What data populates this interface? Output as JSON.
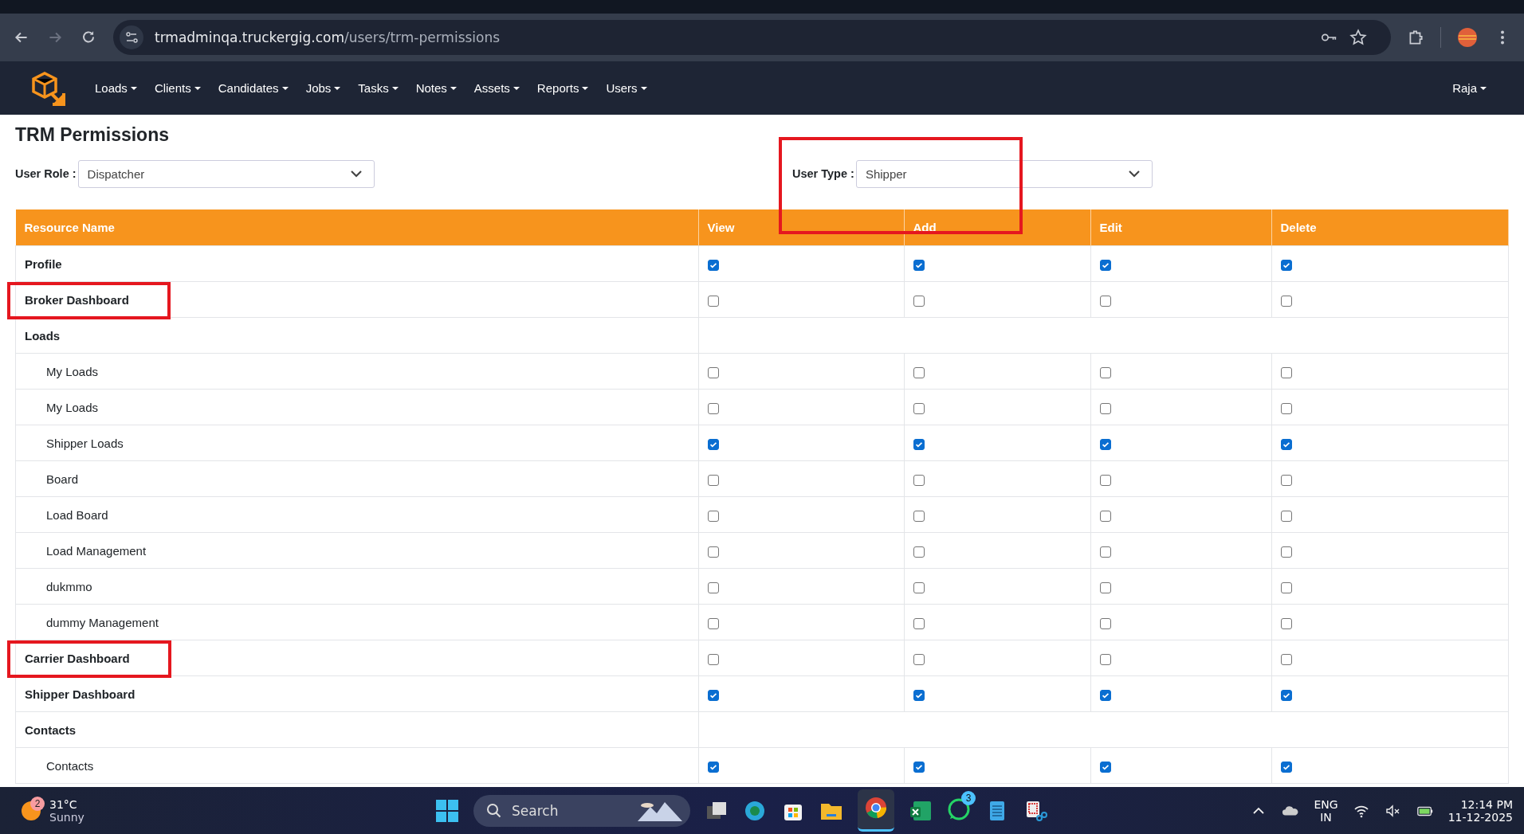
{
  "browser": {
    "url_host": "trmadminqa.truckergig.com",
    "url_path": "/users/trm-permissions"
  },
  "nav": {
    "items": [
      {
        "label": "Loads"
      },
      {
        "label": "Clients"
      },
      {
        "label": "Candidates"
      },
      {
        "label": "Jobs"
      },
      {
        "label": "Tasks"
      },
      {
        "label": "Notes"
      },
      {
        "label": "Assets"
      },
      {
        "label": "Reports"
      },
      {
        "label": "Users"
      }
    ],
    "user": "Raja"
  },
  "page": {
    "title": "TRM Permissions"
  },
  "filters": [
    {
      "label": "User Role :",
      "value": "Dispatcher",
      "highlighted": false
    },
    {
      "label": "User Type :",
      "value": "Shipper",
      "highlighted": true
    }
  ],
  "table": {
    "columns": [
      "Resource Name",
      "View",
      "Add",
      "Edit",
      "Delete"
    ],
    "rows": [
      {
        "name": "Profile",
        "kind": "top",
        "highlighted": false,
        "perms": [
          true,
          true,
          true,
          true
        ]
      },
      {
        "name": "Broker Dashboard",
        "kind": "top",
        "highlighted": true,
        "perms": [
          false,
          false,
          false,
          false
        ]
      },
      {
        "name": "Loads",
        "kind": "group",
        "highlighted": false
      },
      {
        "name": "My Loads",
        "kind": "sub",
        "highlighted": false,
        "perms": [
          false,
          false,
          false,
          false
        ]
      },
      {
        "name": "My Loads",
        "kind": "sub",
        "highlighted": false,
        "perms": [
          false,
          false,
          false,
          false
        ]
      },
      {
        "name": "Shipper Loads",
        "kind": "sub",
        "highlighted": false,
        "perms": [
          true,
          true,
          true,
          true
        ]
      },
      {
        "name": "Board",
        "kind": "sub",
        "highlighted": false,
        "perms": [
          false,
          false,
          false,
          false
        ]
      },
      {
        "name": "Load Board",
        "kind": "sub",
        "highlighted": false,
        "perms": [
          false,
          false,
          false,
          false
        ]
      },
      {
        "name": "Load Management",
        "kind": "sub",
        "highlighted": false,
        "perms": [
          false,
          false,
          false,
          false
        ]
      },
      {
        "name": "dukmmo",
        "kind": "sub",
        "highlighted": false,
        "perms": [
          false,
          false,
          false,
          false
        ]
      },
      {
        "name": "dummy Management",
        "kind": "sub",
        "highlighted": false,
        "perms": [
          false,
          false,
          false,
          false
        ]
      },
      {
        "name": "Carrier Dashboard",
        "kind": "top",
        "highlighted": true,
        "perms": [
          false,
          false,
          false,
          false
        ]
      },
      {
        "name": "Shipper Dashboard",
        "kind": "top",
        "highlighted": false,
        "perms": [
          true,
          true,
          true,
          true
        ]
      },
      {
        "name": "Contacts",
        "kind": "group",
        "highlighted": false
      },
      {
        "name": "Contacts",
        "kind": "sub",
        "highlighted": false,
        "perms": [
          true,
          true,
          true,
          true
        ]
      }
    ]
  },
  "taskbar": {
    "weather": {
      "badge": "2",
      "temp": "31°C",
      "condition": "Sunny"
    },
    "search": {
      "placeholder": "Search"
    },
    "whatsapp_badge": "3",
    "language": [
      "ENG",
      "IN"
    ],
    "time": "12:14 PM",
    "date": "11-12-2025"
  }
}
